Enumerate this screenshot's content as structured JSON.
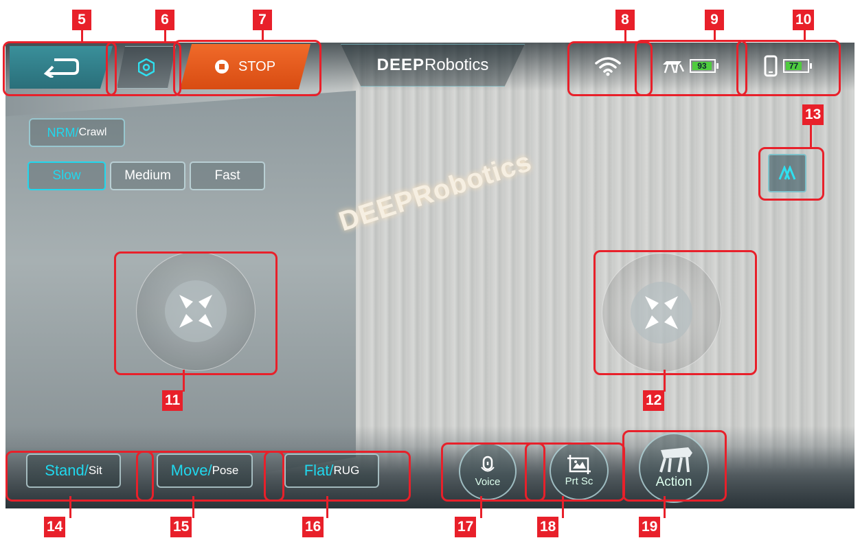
{
  "brand": {
    "bold": "DEEP",
    "light": "Robotics"
  },
  "wall_sign": "DEEPRobotics",
  "top": {
    "stop_label": "STOP"
  },
  "status": {
    "robot_battery": "93",
    "phone_battery": "77",
    "robot_battery_level": 0.93,
    "phone_battery_level": 0.77
  },
  "mode": {
    "primary": "NRM",
    "separator": "/",
    "secondary": "Crawl"
  },
  "speeds": [
    {
      "label": "Slow",
      "active": true
    },
    {
      "label": "Medium",
      "active": false
    },
    {
      "label": "Fast",
      "active": false
    }
  ],
  "bottom": {
    "stand": {
      "primary": "Stand",
      "separator": "/",
      "secondary": "Sit"
    },
    "move": {
      "primary": "Move",
      "separator": "/",
      "secondary": "Pose"
    },
    "flat": {
      "primary": "Flat",
      "separator": "/",
      "secondary": "RUG"
    },
    "voice_label": "Voice",
    "prtsc_label": "Prt Sc",
    "action_label": "Action"
  },
  "callouts": [
    "5",
    "6",
    "7",
    "8",
    "9",
    "10",
    "11",
    "12",
    "13",
    "14",
    "15",
    "16",
    "17",
    "18",
    "19"
  ],
  "colors": {
    "accent": "#20d8ee",
    "stop": "#e0551a",
    "callout": "#e8202a",
    "battery": "#4fcc3e"
  }
}
